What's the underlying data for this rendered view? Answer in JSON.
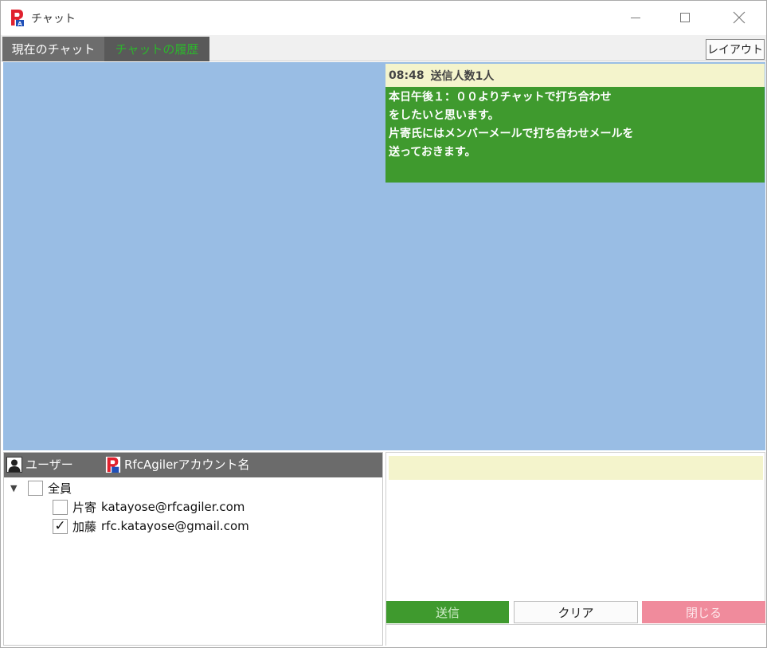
{
  "window": {
    "title": "チャット",
    "accent_color": "#e0212e",
    "controls": [
      "minimize-icon",
      "maximize-icon",
      "close-icon"
    ]
  },
  "tabs": {
    "current": "現在のチャット",
    "history": "チャットの履歴",
    "active": "history"
  },
  "toolbar": {
    "layout_label": "レイアウト"
  },
  "chat": {
    "background_color": "#99bde4",
    "messages": [
      {
        "time": "08:48",
        "recipients": "送信人数1人",
        "lines": [
          "本日午後１：００よりチャットで打ち合わせ",
          "をしたいと思います。",
          "片寄氏にはメンバーメールで打ち合わせメールを",
          "送っておきます。"
        ]
      }
    ]
  },
  "users": {
    "header_user": "ユーザー",
    "header_account": "RfcAgilerアカウント名",
    "tree": {
      "label": "全員",
      "checked": false,
      "expanded": true,
      "children": [
        {
          "name": "片寄",
          "account": "katayose@rfcagiler.com",
          "checked": false,
          "check_mark": ""
        },
        {
          "name": "加藤",
          "account": "rfc.katayose@gmail.com",
          "checked": true,
          "check_mark": "✓"
        }
      ]
    }
  },
  "input": {
    "value": "",
    "status": ""
  },
  "buttons": {
    "send": "送信",
    "clear": "クリア",
    "close": "閉じる"
  },
  "colors": {
    "send": "#3f9a2e",
    "close": "#f08b9c",
    "message_header": "#f4f4cc",
    "message_body": "#3f9a2e"
  }
}
